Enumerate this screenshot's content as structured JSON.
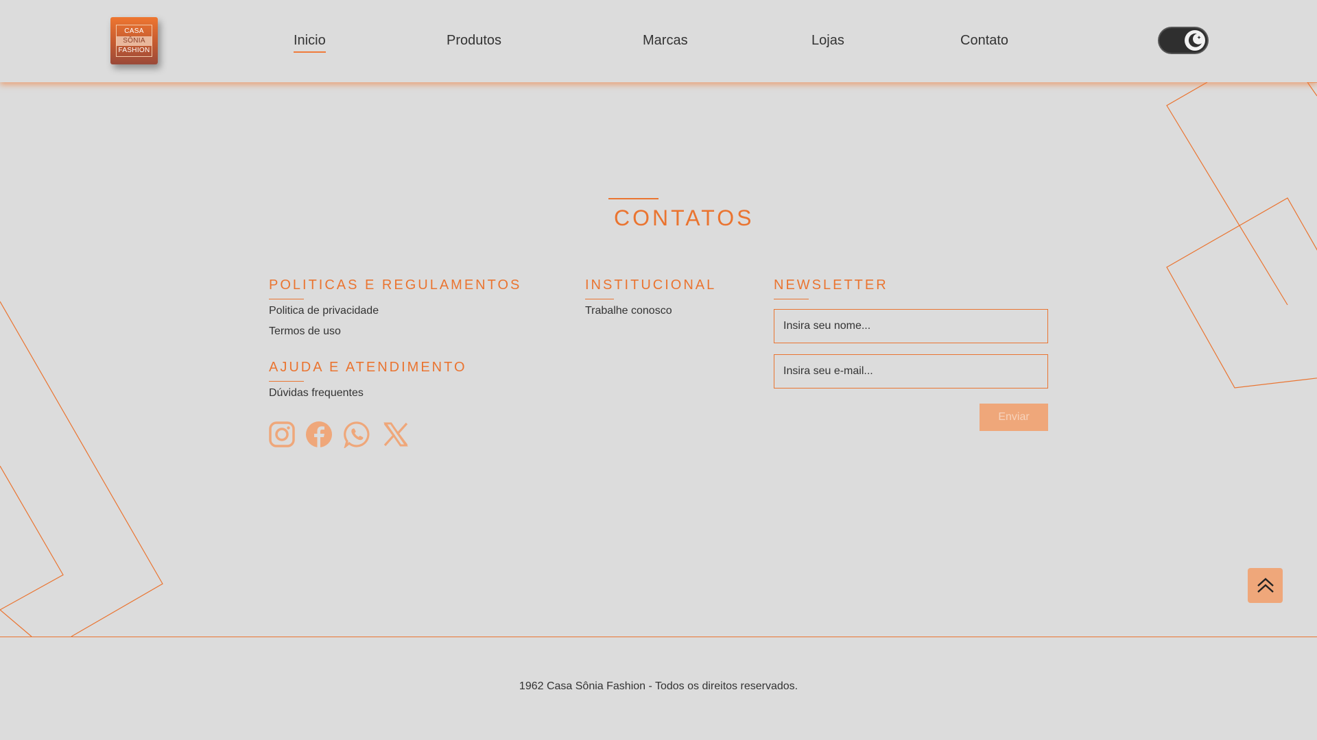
{
  "logo": {
    "line1": "CASA",
    "line2": "SÔNIA",
    "line3": "FASHION"
  },
  "nav": {
    "items": [
      {
        "label": "Inicio"
      },
      {
        "label": "Produtos"
      },
      {
        "label": "Marcas"
      },
      {
        "label": "Lojas"
      },
      {
        "label": "Contato"
      }
    ],
    "active": "Inicio"
  },
  "theme_toggle": {
    "icon": "moon-icon",
    "state": "dark"
  },
  "contacts": {
    "title": "CONTATOS",
    "policies": {
      "heading": "POLITICAS E REGULAMENTOS",
      "links": [
        "Politica de privacidade",
        "Termos de uso"
      ]
    },
    "help": {
      "heading": "AJUDA E ATENDIMENTO",
      "links": [
        "Dúvidas frequentes"
      ]
    },
    "institutional": {
      "heading": "INSTITUCIONAL",
      "links": [
        "Trabalhe conosco"
      ]
    },
    "newsletter": {
      "heading": "NEWSLETTER",
      "name_placeholder": "Insira seu nome...",
      "email_placeholder": "Insira seu e-mail...",
      "submit_label": "Enviar"
    },
    "social": [
      "instagram-icon",
      "facebook-icon",
      "whatsapp-icon",
      "x-icon"
    ]
  },
  "back_to_top": {
    "icon": "double-chevron-up-icon"
  },
  "footer": {
    "copyright": "1962 Casa Sônia Fashion - Todos os direitos reservados."
  },
  "colors": {
    "accent": "#ea7430",
    "background": "#dcdcdc",
    "accent_light": "#efa77a"
  }
}
